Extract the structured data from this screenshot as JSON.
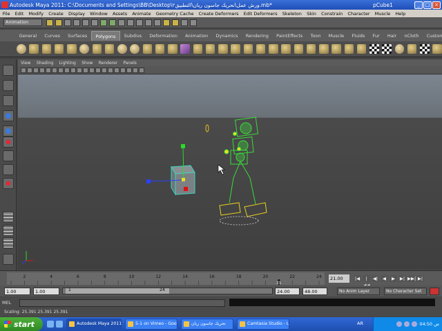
{
  "titlebar": {
    "title": "Autodesk Maya 2011: C:\\Documents and Settings\\BB\\Desktop\\ورش عمل\\تحريك جاسون ريان\\التطبيق٢.mb*",
    "selected_object": "pCube1",
    "minimize_label": "_",
    "maximize_label": "□",
    "close_label": "×"
  },
  "menubar": [
    "File",
    "Edit",
    "Modify",
    "Create",
    "Display",
    "Window",
    "Assets",
    "Animate",
    "Geometry Cache",
    "Create Deformers",
    "Edit Deformers",
    "Skeleton",
    "Skin",
    "Constrain",
    "Character",
    "Muscle",
    "Help"
  ],
  "statusline": {
    "mode": "Animation"
  },
  "shelf": {
    "tabs": [
      "General",
      "Curves",
      "Surfaces",
      "Polygons",
      "Subdivs",
      "Deformation",
      "Animation",
      "Dynamics",
      "Rendering",
      "PaintEffects",
      "Toon",
      "Muscle",
      "Fluids",
      "Fur",
      "Hair",
      "nCloth",
      "Custom"
    ],
    "active_tab": "Polygons"
  },
  "panel": {
    "menu": [
      "View",
      "Shading",
      "Lighting",
      "Show",
      "Renderer",
      "Panels"
    ]
  },
  "timeline": {
    "ticks": [
      "2",
      "4",
      "6",
      "8",
      "10",
      "12",
      "14",
      "16",
      "18",
      "20",
      "22",
      "24"
    ],
    "current_marker": "21",
    "current_frame": "21.00",
    "playback_buttons": [
      "|◀",
      "|◀◀",
      "◀|",
      "◀",
      "▶",
      "▶|",
      "▶▶|",
      "▶|"
    ]
  },
  "range": {
    "start_time": "1.00",
    "playback_start": "1.00",
    "range_start_label": "1",
    "range_end_label": "24",
    "playback_end": "24.00",
    "end_time": "48.00",
    "anim_layer": "No Anim Layer",
    "character_set": "No Character Set"
  },
  "cmdline": {
    "label": "MEL"
  },
  "helpline": {
    "text": "Scaling:   25.391    25.391    25.391"
  },
  "taskbar": {
    "start_label": "start",
    "tasks": [
      "Autodesk Maya 2011...",
      "5-1 on Vimeo - Googl...",
      "تحريك جاسون ريان",
      "Camtasia Studio - Unt..."
    ],
    "language": "AR",
    "clock": "ص 04:50"
  }
}
